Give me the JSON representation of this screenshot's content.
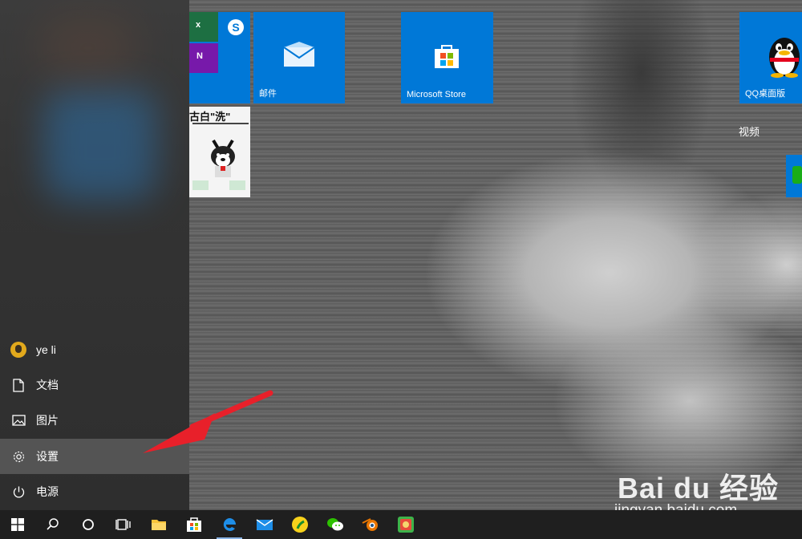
{
  "user": {
    "name": "ye li"
  },
  "rail": {
    "documents": "文档",
    "pictures": "图片",
    "settings": "设置",
    "power": "电源"
  },
  "tiles": {
    "mail": "邮件",
    "store": "Microsoft Store",
    "qq": "QQ桌面版",
    "video": "视频",
    "image_caption": "古白\"洗\""
  },
  "watermark": {
    "brand": "Bai du 经验",
    "url": "jingyan.baidu.com"
  },
  "taskbar": {
    "items": [
      "start-icon",
      "search-icon",
      "cortana-icon",
      "task-view-icon",
      "file-explorer-icon",
      "store-icon",
      "edge-icon",
      "mail-icon",
      "kuwo-music-icon",
      "wechat-icon",
      "blender-icon",
      "app-icon"
    ]
  },
  "colors": {
    "tile": "#0078d7",
    "arrow": "#e8202a",
    "taskbar": "#1f1f1f"
  }
}
